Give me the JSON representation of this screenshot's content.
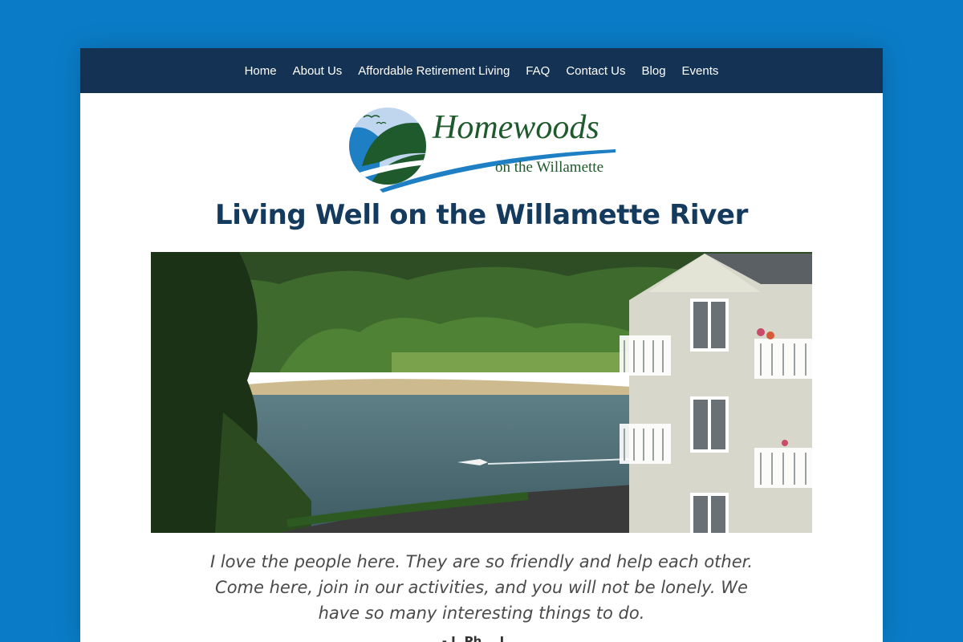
{
  "nav": {
    "items": [
      {
        "label": "Home"
      },
      {
        "label": "About Us"
      },
      {
        "label": "Affordable Retirement Living"
      },
      {
        "label": "FAQ"
      },
      {
        "label": "Contact Us"
      },
      {
        "label": "Blog"
      },
      {
        "label": "Events"
      }
    ]
  },
  "logo": {
    "name": "Homewoods",
    "tagline": "on the Willamette"
  },
  "headline": "Living Well on the Willamette River",
  "testimonial": {
    "quote": "I love the people here. They are so friendly and help each other. Come here, join in our activities, and you will not be lonely. We have so many interesting things to do.",
    "attribution": "- J. Ph... L..."
  },
  "colors": {
    "page_background": "#0a7cc7",
    "nav_background": "#143254",
    "headline": "#143a5e",
    "logo_green": "#1f5a2c",
    "logo_blue": "#1e7fc4"
  }
}
